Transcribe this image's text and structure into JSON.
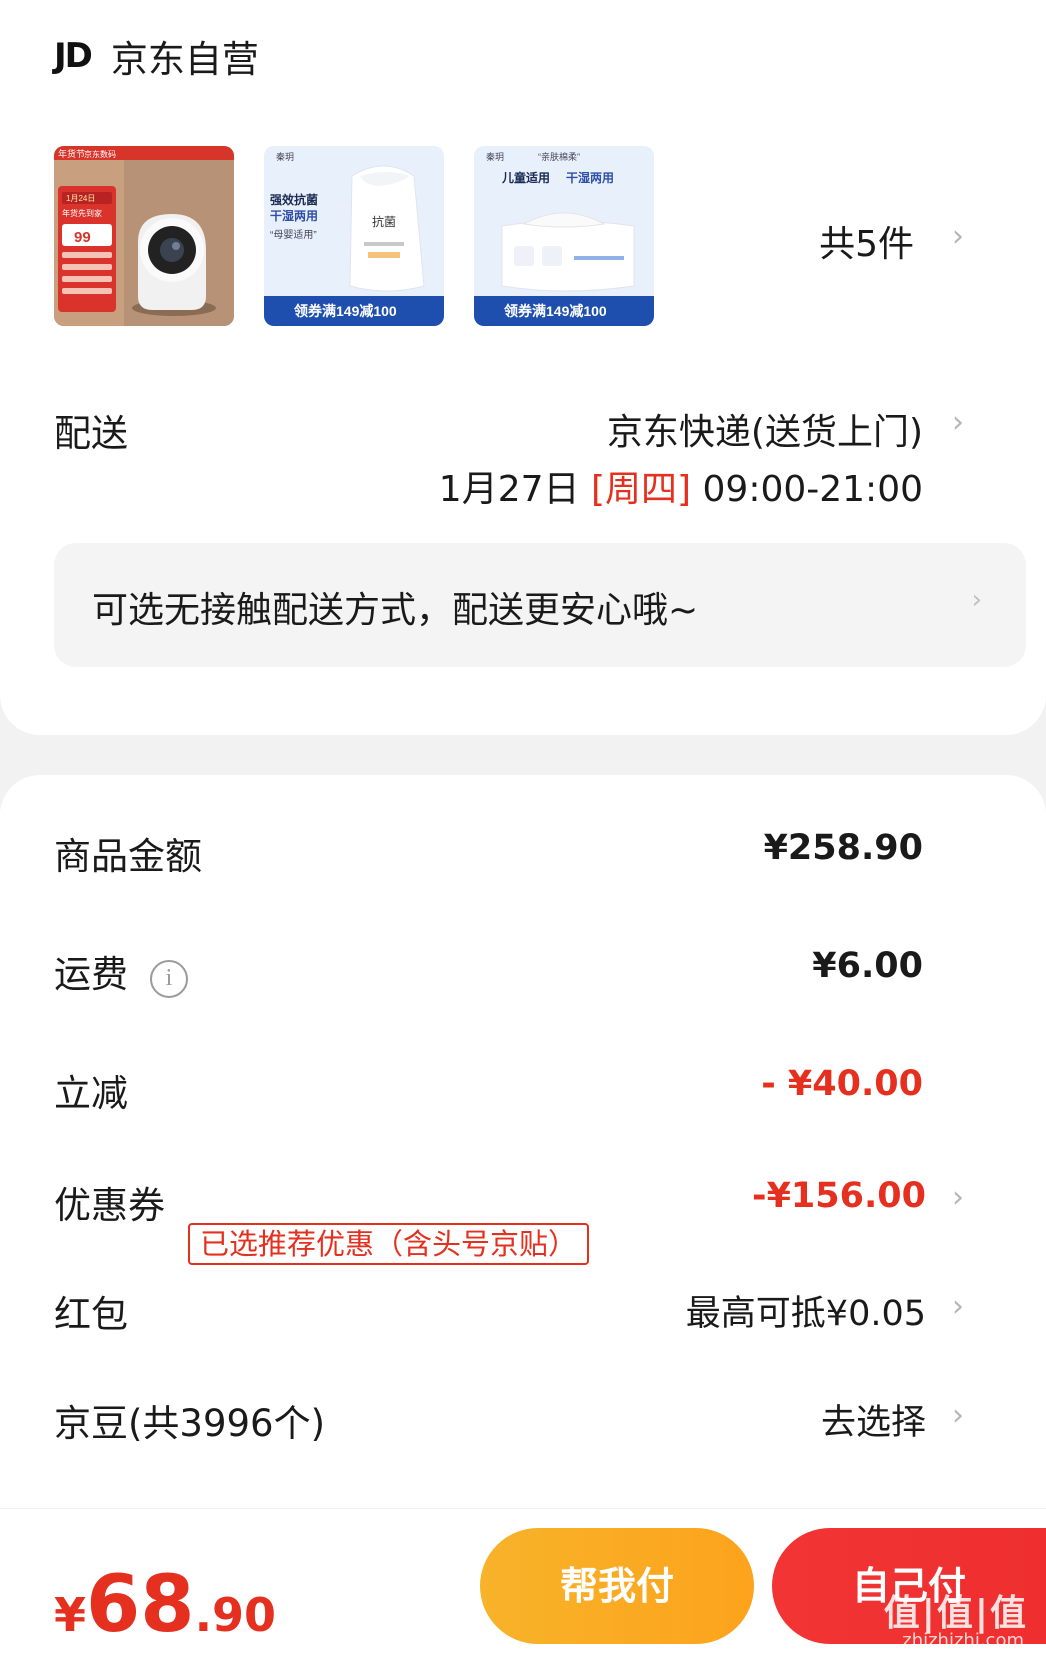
{
  "shop": {
    "logo": "JD",
    "name": "京东自营"
  },
  "products": {
    "item1_badge_top": "年货节",
    "item1_badge_brand": "京东数码",
    "item1_promo_date": "1月24日",
    "item1_promo_line": "年货先到家",
    "item1_price": "99",
    "item2_brand": "秦玥",
    "item2_line1": "强效抗菌",
    "item2_line2": "干湿两用",
    "item2_line3": "“母婴适用”",
    "item2_pack": "抗菌",
    "item2_coupon": "领券满149减100",
    "item3_brand": "秦玥",
    "item3_slogan": "“亲肤棉柔”",
    "item3_line1": "儿童适用",
    "item3_line2": "干湿两用",
    "item3_coupon": "领券满149减100",
    "count_label": "共5件"
  },
  "delivery": {
    "label": "配送",
    "method": "京东快递(送货上门)",
    "date": "1月27日",
    "weekday": "[周四]",
    "time": "09:00-21:00"
  },
  "notice": {
    "text": "可选无接触配送方式，配送更安心哦~"
  },
  "summary": {
    "goods_label": "商品金额",
    "goods_value": "¥258.90",
    "shipping_label": "运费",
    "shipping_value": "¥6.00",
    "discount_label": "立减",
    "discount_value": "- ¥40.00",
    "coupon_label": "优惠券",
    "coupon_tag": "已选推荐优惠（含头号京贴）",
    "coupon_value": "-¥156.00",
    "redpack_label": "红包",
    "redpack_value": "最高可抵¥0.05",
    "beans_label": "京豆(共3996个)",
    "beans_value": "去选择"
  },
  "footer": {
    "currency": "¥",
    "price_int": "68",
    "price_dec": ".90",
    "help_pay": "帮我付",
    "self_pay": "自己付"
  },
  "watermark": {
    "text": "值|值|值",
    "site": "zhizhizhi.com"
  },
  "colors": {
    "accent_red": "#e6301f",
    "help_orange": "#f8ac24",
    "self_red": "#f23434"
  }
}
